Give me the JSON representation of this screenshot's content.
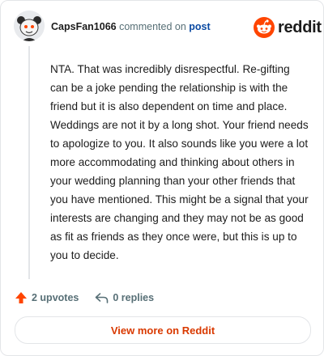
{
  "header": {
    "username": "CapsFan1066",
    "action_text": "commented on",
    "post_link": "post"
  },
  "brand": {
    "name": "reddit"
  },
  "comment": {
    "body": "NTA. That was incredibly disrespectful. Re-gifting can be a joke pending the relationship is with the friend but it is also dependent on time and place. Weddings are not it by a long shot. Your friend needs to apologize to you. It also sounds like you were a lot more accommodating and thinking about others in your wedding planning than your other friends that you have mentioned. This might be a signal that your interests are changing and they may not be as good as fit as friends as they once were, but this is up to you to decide."
  },
  "actions": {
    "upvotes": "2 upvotes",
    "replies": "0 replies"
  },
  "footer": {
    "view_more": "View more on Reddit"
  },
  "colors": {
    "accent": "#d93900",
    "upvote": "#ff4500",
    "link": "#0b4aa2",
    "text": "#1c1c1c",
    "muted": "#576f76"
  },
  "icons": {
    "avatar": "snoo-avatar-icon",
    "brand": "reddit-logo-icon",
    "upvote": "upvote-arrow-icon",
    "reply": "reply-arrow-icon"
  }
}
